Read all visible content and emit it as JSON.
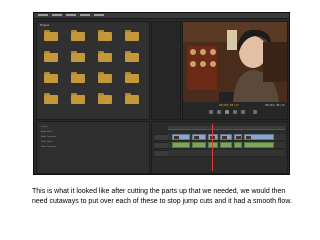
{
  "window": {
    "app": "Adobe Premiere Pro"
  },
  "project_panel": {
    "title": "Project",
    "folders": [
      "",
      "",
      "",
      "",
      "",
      "",
      "",
      "",
      "",
      "",
      "",
      "",
      "",
      "",
      "",
      ""
    ]
  },
  "program_monitor": {
    "timecode_left": "00;00;05;17",
    "timecode_right": "00;02;40;11"
  },
  "effects_panel": {
    "rows": [
      "Presets",
      "Audio Effects",
      "Audio Transitions",
      "Video Effects",
      "Video Transitions"
    ]
  },
  "timeline": {
    "tracks": [
      "Video 1",
      "Audio 1",
      "Audio 2"
    ]
  },
  "caption": "This is what it looked like after cutting the parts up that we needed, we would then need cutaways to put over each of these to stop jump cuts and it had a smooth flow.",
  "colors": {
    "clip_video": "#8aa7c9",
    "clip_audio": "#79a55e",
    "timecode": "#e8b23a",
    "playhead": "#e03b3b"
  }
}
